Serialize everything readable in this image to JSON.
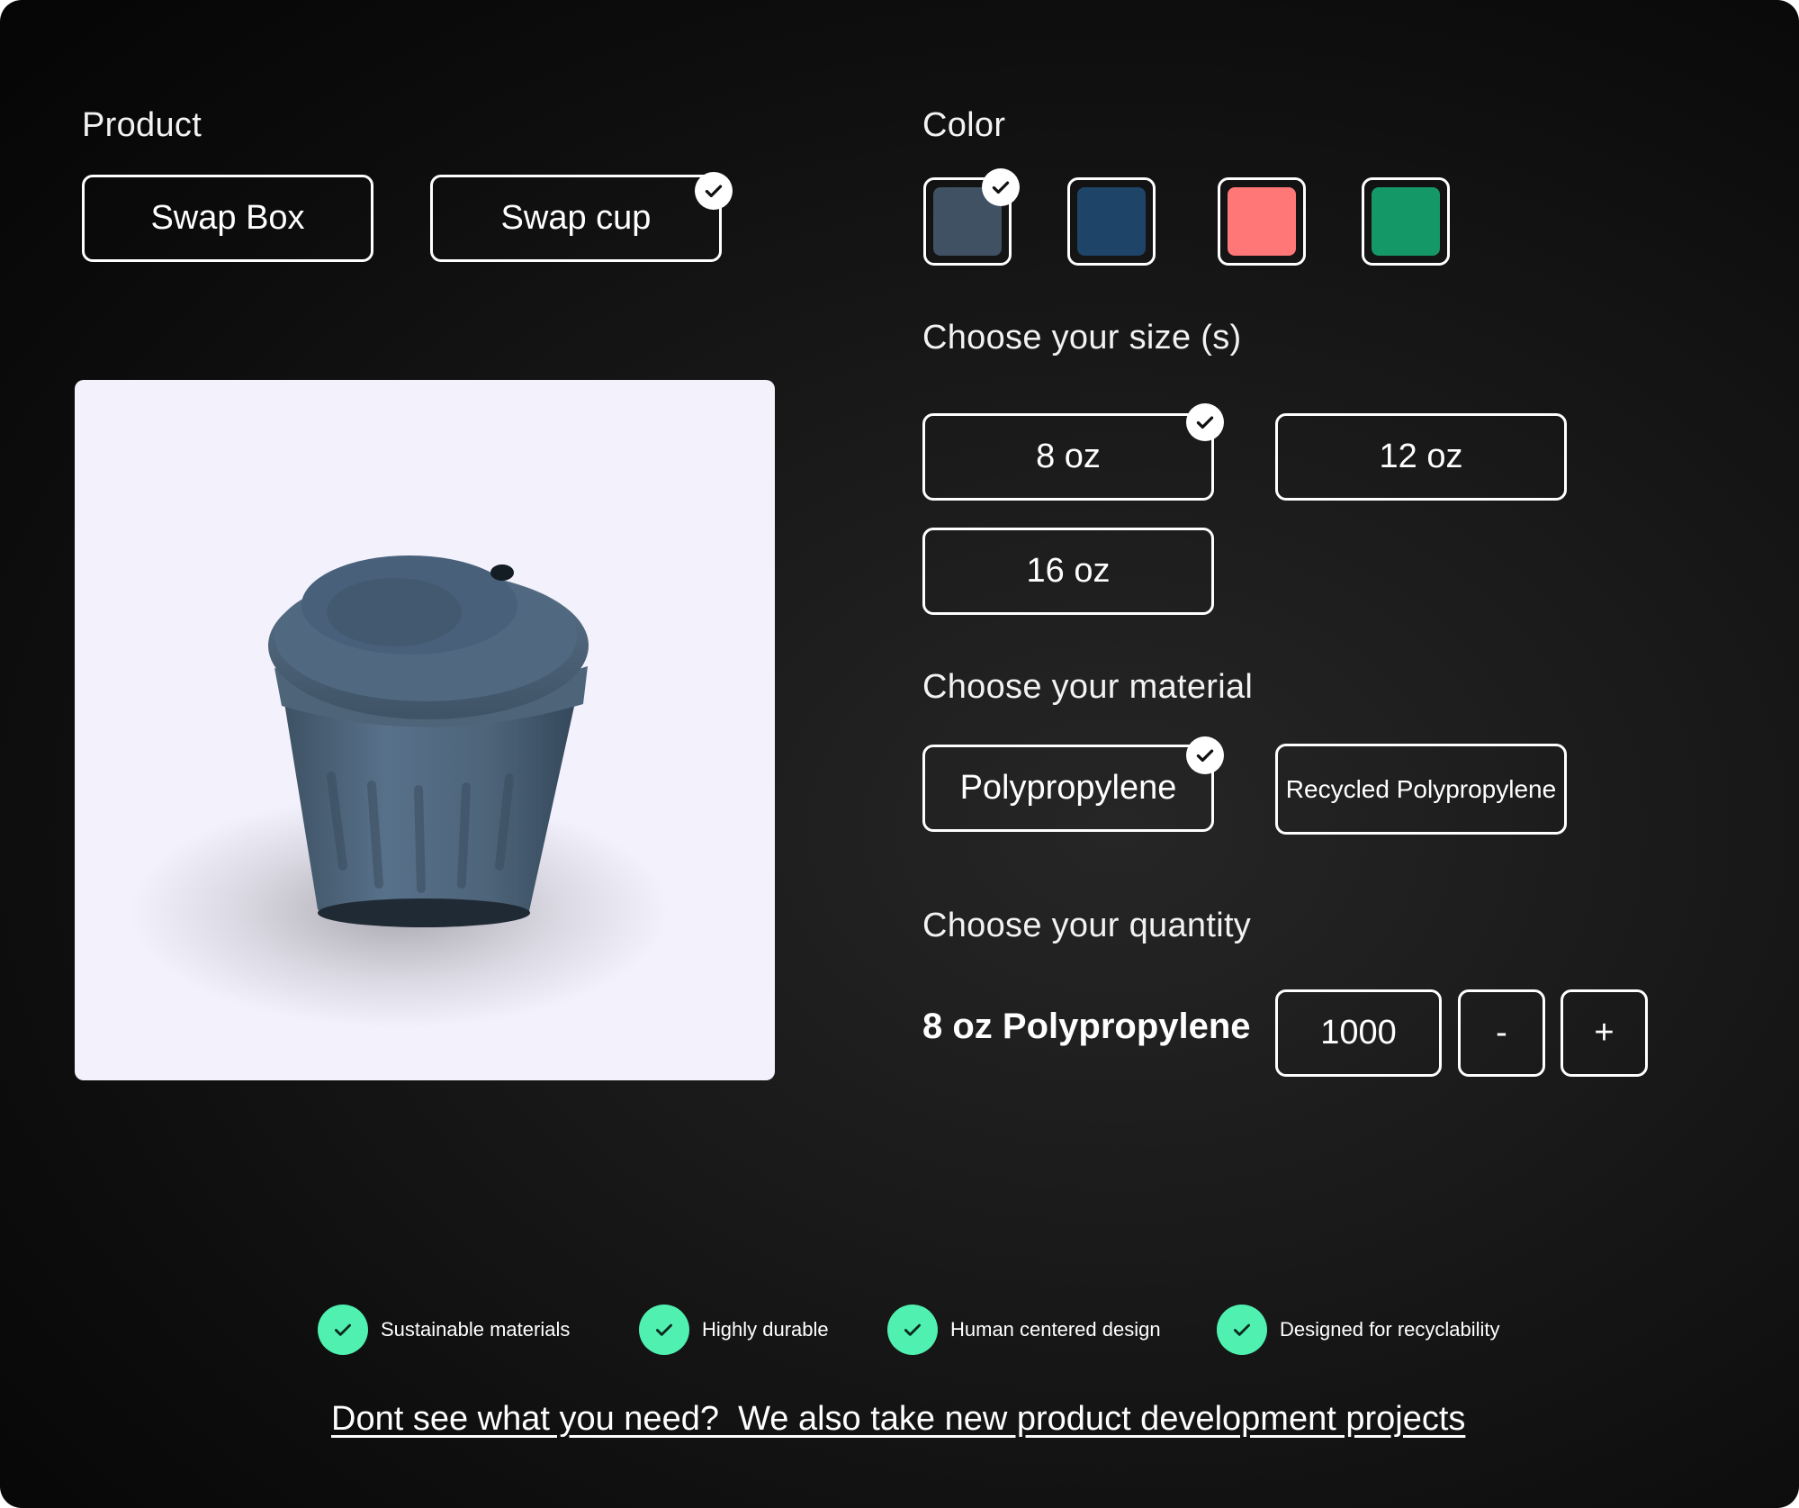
{
  "product": {
    "label": "Product",
    "options": [
      "Swap Box",
      "Swap cup"
    ],
    "selected": "Swap cup"
  },
  "color": {
    "label": "Color",
    "swatches": [
      "#3f5162",
      "#1e4468",
      "#ff7777",
      "#159868"
    ],
    "selected_index": 0
  },
  "size": {
    "label": "Choose your size (s)",
    "options": [
      "8 oz",
      "12 oz",
      "16 oz"
    ],
    "selected": "8 oz"
  },
  "material": {
    "label": "Choose your material",
    "options": [
      "Polypropylene",
      "Recycled Polypropylene"
    ],
    "selected": "Polypropylene"
  },
  "quantity": {
    "label": "Choose your quantity",
    "item_label": "8 oz Polypropylene",
    "value": "1000",
    "decrement_label": "-",
    "increment_label": "+"
  },
  "features": [
    "Sustainable materials",
    "Highly durable",
    "Human centered design",
    "Designed for recyclability"
  ],
  "footer": {
    "link_text": "Dont see what you need?  We also take new product development projects"
  },
  "accent_color": "#4ff0b0"
}
